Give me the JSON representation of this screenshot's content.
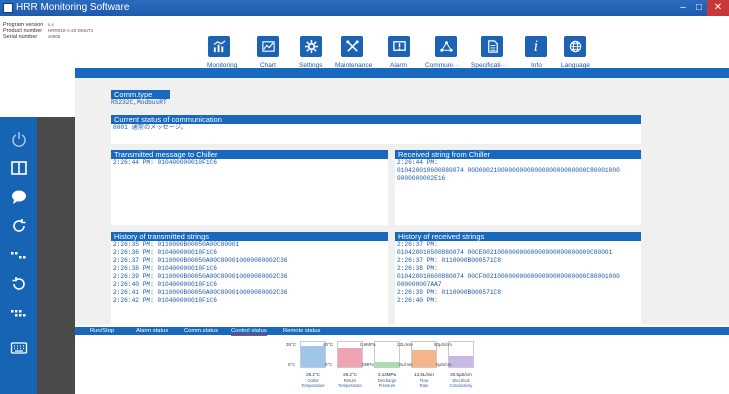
{
  "window": {
    "title": "HRR Monitoring Software",
    "min_glyph": "–",
    "max_glyph": "□",
    "close_glyph": "✕"
  },
  "header": {
    "program_version_label": "Program version",
    "program_version": "x.x",
    "product_number_label": "Product number",
    "product_number": "HRR010-A-20-DMUT1",
    "serial_number_label": "Serial number",
    "serial_number": "x0000"
  },
  "nav": [
    {
      "label": "Monitoring",
      "icon": "monitoring-icon"
    },
    {
      "label": "Chart",
      "icon": "chart-icon"
    },
    {
      "label": "Settings",
      "icon": "gear-icon"
    },
    {
      "label": "Maintenance",
      "icon": "tools-icon"
    },
    {
      "label": "Alarm",
      "icon": "alarm-icon"
    },
    {
      "label": "Communi···",
      "icon": "network-icon"
    },
    {
      "label": "Specificati···",
      "icon": "document-icon"
    },
    {
      "label": "Info",
      "icon": "info-icon"
    },
    {
      "label": "Language",
      "icon": "globe-icon"
    }
  ],
  "sidebar": [
    {
      "name": "power-icon"
    },
    {
      "name": "panel-icon"
    },
    {
      "name": "chat-icon"
    },
    {
      "name": "refresh-icon"
    },
    {
      "name": "sequence-icon"
    },
    {
      "name": "rotate-icon"
    },
    {
      "name": "dots-icon"
    },
    {
      "name": "keyboard-icon"
    }
  ],
  "comm": {
    "title": "Comm.type",
    "value": "RS232C,ModbusRT"
  },
  "current_status": {
    "title": "Current status of communication",
    "value": "8001  通常のメッセージ。"
  },
  "transmitted": {
    "title": "Transmitted message to Chiller",
    "value": "2:26:44 PM:  010400000010F1C6"
  },
  "received": {
    "title": "Received string from Chiller",
    "lines": [
      "2:26:44 PM:",
      "010420010600880074 00D00021000000000000000000000000C80001000",
      "0000000002E16"
    ]
  },
  "history_tx": {
    "title": "History of transmitted strings",
    "lines": [
      "2:26:35 PM:  0110000B00050A00C80001",
      "2:26:36 PM:  010400000010F1C6",
      "2:26:37 PM:  0110000B00050A00C800010000000002C36",
      "2:26:38 PM:  010400000010F1C6",
      "2:26:39 PM:  0110000B00050A00C800010000000002C36",
      "2:26:40 PM:  010400000010F1C6",
      "2:26:41 PM:  0110000B00050A00C800010000000002C36",
      "2:26:42 PM:  010400000010F1C6"
    ]
  },
  "history_rx": {
    "title": "History of received strings",
    "lines": [
      "2:26:37 PM:",
      "010420010500880074 00CE00210000000000000000000000000C80001",
      "2:26:37 PM:  0110000B000571C8",
      "2:26:38 PM:",
      "010420010600880074 00CF0021000000000000000000000000C80001000",
      "000000007AA7",
      "2:26:39 PM:  0110000B000571C8",
      "2:26:40 PM:"
    ]
  },
  "status_tabs": [
    {
      "label": "Run/Stop"
    },
    {
      "label": "Alarm status"
    },
    {
      "label": "Comm.status"
    },
    {
      "label": "Control status",
      "active": true
    },
    {
      "label": "Remote status"
    }
  ],
  "gauges": [
    {
      "max": "35°C",
      "min": "5°C",
      "value": "28.2°C",
      "label1": "Outlet",
      "label2": "Temperature",
      "level": 0.77,
      "color": "#9fc6e8"
    },
    {
      "max": "40°C",
      "min": "0°C",
      "value": "28.2°C",
      "label1": "Return",
      "label2": "Temperature",
      "level": 0.7,
      "color": "#f0a3b3"
    },
    {
      "max": "0.6MPa",
      "min": "0MPa",
      "value": "0.12MPa",
      "label1": "Discharge",
      "label2": "Pressure",
      "level": 0.2,
      "color": "#a9dea9"
    },
    {
      "max": "22L/min",
      "min": "0L/min",
      "value": "13.6L/min",
      "label1": "Flow",
      "label2": "Rate",
      "level": 0.62,
      "color": "#f6b48a"
    },
    {
      "max": "50µS/cm",
      "min": "0µS/cm",
      "value": "20.6µS/cm",
      "label1": "Electrical",
      "label2": "Conductivity",
      "level": 0.41,
      "color": "#c8b8e4"
    }
  ]
}
